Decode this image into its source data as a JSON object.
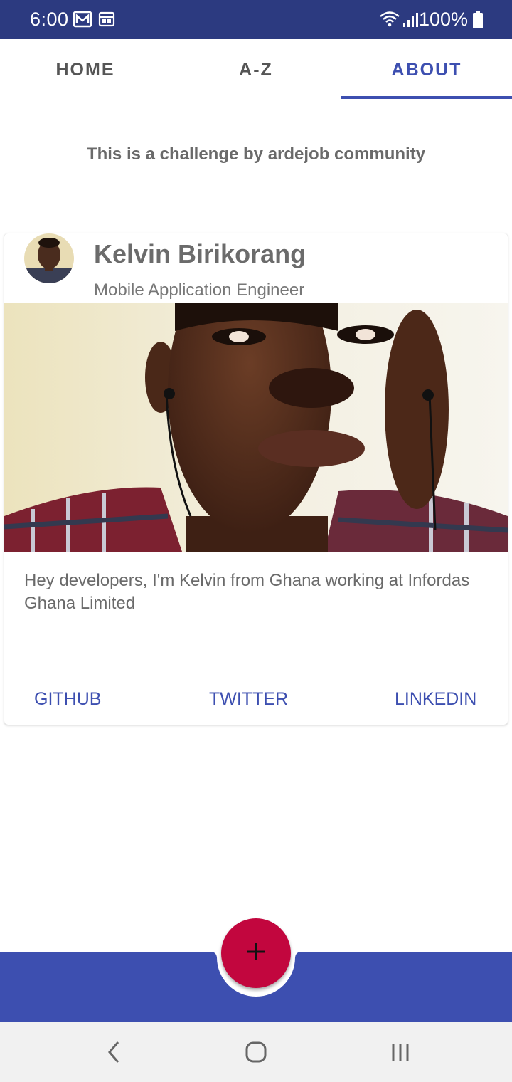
{
  "status_bar": {
    "time": "6:00",
    "battery": "100%",
    "icons": [
      "gmail-icon",
      "calendar-icon",
      "wifi-icon",
      "signal-icon",
      "battery-icon"
    ]
  },
  "tabs": [
    {
      "label": "HOME",
      "active": false
    },
    {
      "label": "A-Z",
      "active": false
    },
    {
      "label": "ABOUT",
      "active": true
    }
  ],
  "intro_text": "This is a challenge by ardejob community",
  "profile": {
    "name": "Kelvin Birikorang",
    "role": "Mobile Application Engineer",
    "bio": "Hey developers, I'm Kelvin from Ghana working at Infordas Ghana Limited",
    "links": {
      "github": "GITHUB",
      "twitter": "TWITTER",
      "linkedin": "LINKEDIN"
    }
  },
  "fab": {
    "icon": "plus-icon"
  },
  "nav": {
    "icons": [
      "back-icon",
      "home-icon",
      "recents-icon"
    ]
  },
  "colors": {
    "status_bar": "#2c3a80",
    "primary": "#3d4fb0",
    "accent": "#c2063e",
    "text_muted": "#6b6b6b"
  }
}
